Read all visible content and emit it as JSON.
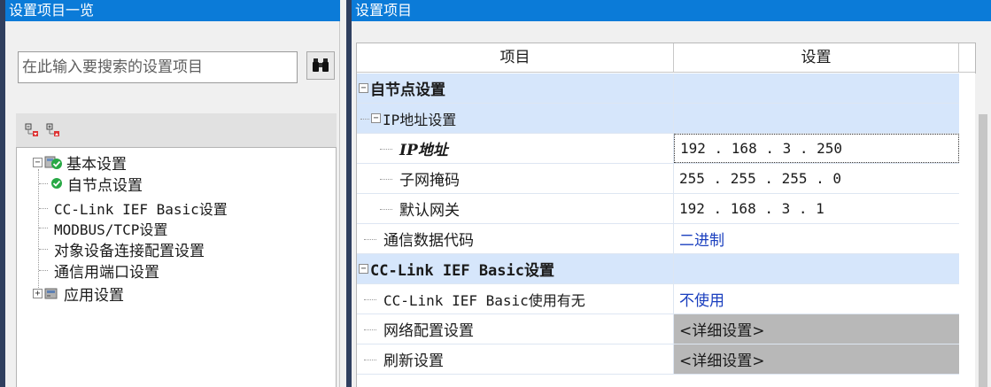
{
  "left_panel": {
    "title": "设置项目一览",
    "search_placeholder": "在此输入要搜索的设置项目"
  },
  "right_panel": {
    "title": "设置项目"
  },
  "tree": {
    "basic": "基本设置",
    "self_node": "自节点设置",
    "cclink": "CC-Link IEF Basic设置",
    "modbus": "MODBUS/TCP设置",
    "target_device": "对象设备连接配置设置",
    "comm_port": "通信用端口设置",
    "app": "应用设置"
  },
  "grid": {
    "header_item": "项目",
    "header_setting": "设置",
    "rows": [
      {
        "label": "自节点设置",
        "value": ""
      },
      {
        "label": "IP地址设置",
        "value": ""
      },
      {
        "label": "IP地址",
        "value": "192 . 168 .   3 . 250"
      },
      {
        "label": "子网掩码",
        "value": "255 . 255 . 255 .   0"
      },
      {
        "label": "默认网关",
        "value": "192 . 168 .   3 .   1"
      },
      {
        "label": "通信数据代码",
        "value": "二进制"
      },
      {
        "label": "CC-Link IEF Basic设置",
        "value": ""
      },
      {
        "label": "CC-Link IEF Basic使用有无",
        "value": "不使用"
      },
      {
        "label": "网络配置设置",
        "value": "<详细设置>"
      },
      {
        "label": "刷新设置",
        "value": "<详细设置>"
      }
    ]
  },
  "colors": {
    "title_bar": "#0b7bd8",
    "row_highlight": "#d6e6fb",
    "value_link": "#1a3fbf",
    "status_ok": "#28a845"
  },
  "icons": [
    "binoculars-icon",
    "collapse-all-icon",
    "expand-all-icon",
    "check-circle-icon",
    "module-icon"
  ]
}
